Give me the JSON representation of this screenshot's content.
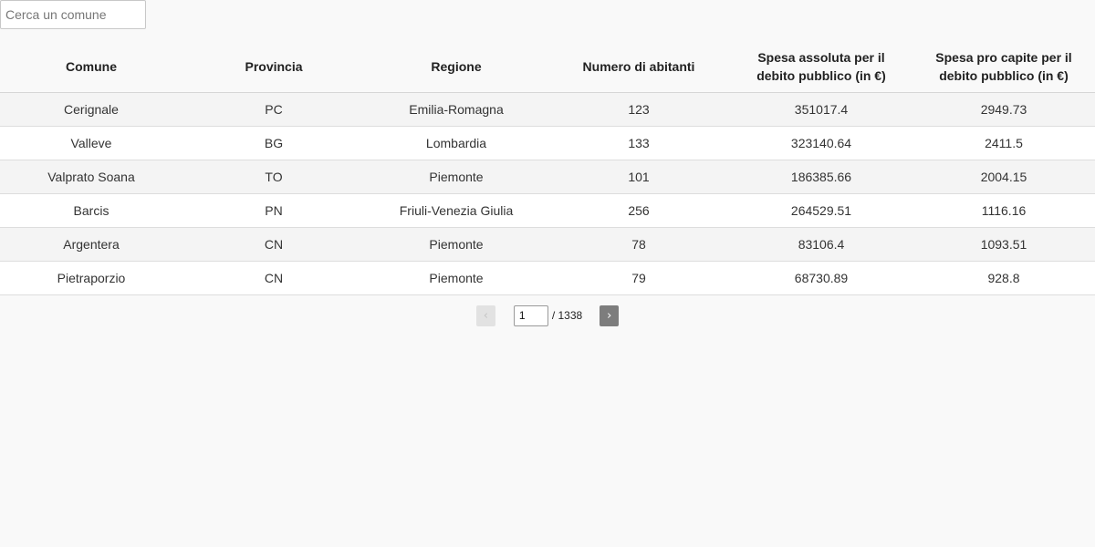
{
  "search": {
    "placeholder": "Cerca un comune",
    "value": ""
  },
  "table": {
    "columns": [
      "Comune",
      "Provincia",
      "Regione",
      "Numero di abitanti",
      "Spesa assoluta per il debito pubblico (in €)",
      "Spesa pro capite per il debito pubblico (in €)"
    ],
    "rows": [
      [
        "Cerignale",
        "PC",
        "Emilia-Romagna",
        "123",
        "351017.4",
        "2949.73"
      ],
      [
        "Valleve",
        "BG",
        "Lombardia",
        "133",
        "323140.64",
        "2411.5"
      ],
      [
        "Valprato Soana",
        "TO",
        "Piemonte",
        "101",
        "186385.66",
        "2004.15"
      ],
      [
        "Barcis",
        "PN",
        "Friuli-Venezia Giulia",
        "256",
        "264529.51",
        "1116.16"
      ],
      [
        "Argentera",
        "CN",
        "Piemonte",
        "78",
        "83106.4",
        "1093.51"
      ],
      [
        "Pietraporzio",
        "CN",
        "Piemonte",
        "79",
        "68730.89",
        "928.8"
      ]
    ]
  },
  "pagination": {
    "prev_label": "‹",
    "next_label": "›",
    "current_page": "1",
    "total_label": "/ 1338"
  }
}
